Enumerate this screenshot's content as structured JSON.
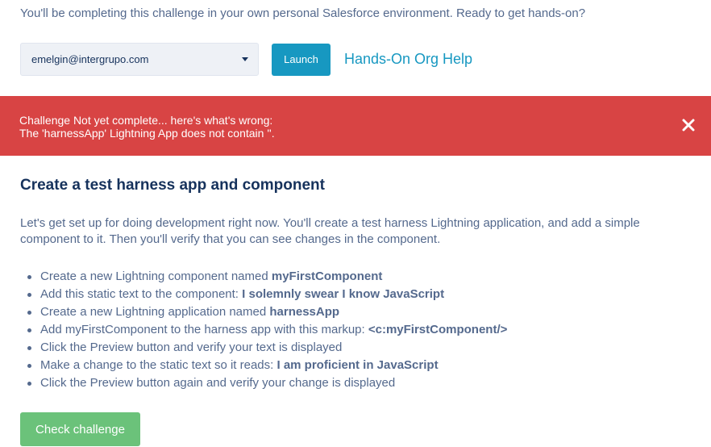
{
  "intro_text": "You'll be completing this challenge in your own personal Salesforce environment. Ready to get hands-on?",
  "org": {
    "selected_org": "emelgin@intergrupo.com",
    "launch_label": "Launch",
    "help_link": "Hands-On Org Help"
  },
  "error": {
    "line1": "Challenge Not yet complete... here's what's wrong:",
    "line2": "The 'harnessApp' Lightning App does not contain ''.",
    "close_icon": "close-icon",
    "color": "#d84444"
  },
  "challenge": {
    "title": "Create a test harness app and component",
    "description": "Let's get set up for doing development right now. You'll create a test harness Lightning application, and add a simple component to it. Then you'll verify that you can see changes in the component.",
    "steps": [
      {
        "text": "Create a new Lightning component named ",
        "bold": "myFirstComponent"
      },
      {
        "text": "Add this static text to the component: ",
        "bold": "I solemnly swear I know JavaScript"
      },
      {
        "text": "Create a new Lightning application named ",
        "bold": "harnessApp"
      },
      {
        "text": "Add myFirstComponent to the harness app with this markup: ",
        "bold": "<c:myFirstComponent/>"
      },
      {
        "text": "Click the Preview button and verify your text is displayed",
        "bold": ""
      },
      {
        "text": "Make a change to the static text so it reads: ",
        "bold": "I am proficient in JavaScript"
      },
      {
        "text": "Click the Preview button again and verify your change is displayed",
        "bold": ""
      }
    ],
    "check_label": "Check challenge"
  },
  "colors": {
    "accent": "#1798c1",
    "success": "#6bc27a",
    "text": "#54698d",
    "heading": "#16325c"
  }
}
